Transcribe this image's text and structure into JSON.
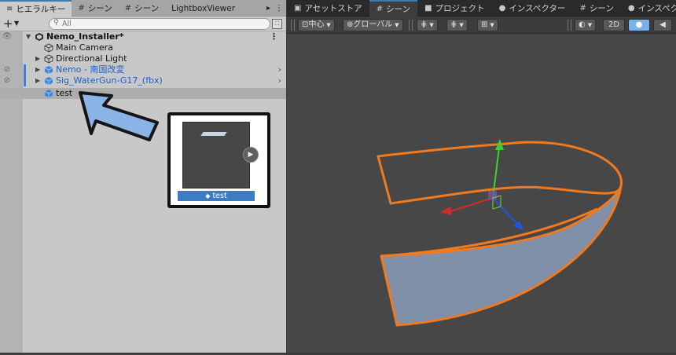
{
  "hierarchy": {
    "tabs": [
      {
        "icon": "≡",
        "label": "ヒエラルキー"
      },
      {
        "icon": "#",
        "label": "シーン"
      },
      {
        "icon": "#",
        "label": "シーン"
      },
      {
        "icon": "",
        "label": "LightboxViewer"
      }
    ],
    "tab_more": "▸",
    "tab_menu": "⋮",
    "add_label": "+",
    "search_placeholder": "All",
    "root": {
      "name": "Nemo_Installer*",
      "menu": "⋮"
    },
    "items": [
      {
        "name": "Main Camera",
        "color": "default"
      },
      {
        "name": "Directional Light",
        "color": "default"
      },
      {
        "name": "Nemo - 南国改変",
        "color": "blue"
      },
      {
        "name": "Sig_WaterGun-G17_(fbx)",
        "color": "blue"
      },
      {
        "name": "test",
        "color": "default",
        "selected": true
      }
    ]
  },
  "preview": {
    "name": "test"
  },
  "scene": {
    "tabs": [
      {
        "icon": "▣",
        "label": "アセットストア"
      },
      {
        "icon": "#",
        "label": "シーン"
      },
      {
        "icon": "■",
        "label": "プロジェクト"
      },
      {
        "icon": "●",
        "label": "インスペクター"
      },
      {
        "icon": "#",
        "label": "シーン"
      },
      {
        "icon": "●",
        "label": "インスペクター"
      }
    ],
    "toolbar": {
      "pivot": "中心",
      "space": "グローバル",
      "mode_2d": "2D"
    }
  },
  "colors": {
    "accent_blue": "#3d7cc4",
    "selection_orange": "#f27a1e",
    "mesh_face": "#8090a8",
    "gizmo_x": "#d42a2a",
    "gizmo_y": "#3ecf35",
    "gizmo_z": "#2454e0",
    "arrow_fill": "#8ab4e6"
  }
}
